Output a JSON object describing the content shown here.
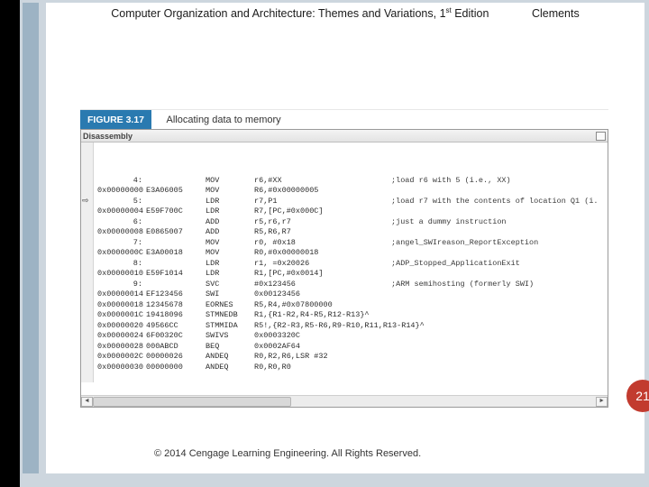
{
  "header": {
    "title_prefix": "Computer Organization and Architecture: Themes and Variations, 1",
    "title_super": "st",
    "title_suffix": " Edition",
    "author": "Clements"
  },
  "figure": {
    "badge": "FIGURE 3.17",
    "caption": "Allocating data to memory",
    "panel_title": "Disassembly",
    "rows": [
      {
        "label": "4:",
        "hex": "",
        "mnem": "MOV",
        "ops": "r6,#XX",
        "cmt": ";load r6 with 5 (i.e., XX)"
      },
      {
        "label": "0x00000000",
        "hex": "E3A06005",
        "mnem": "MOV",
        "ops": "R6,#0x00000005",
        "cmt": ""
      },
      {
        "label": "5:",
        "hex": "",
        "mnem": "LDR",
        "ops": "r7,P1",
        "cmt": ";load r7 with the contents of location Q1 (i."
      },
      {
        "label": "0x00000004",
        "hex": "E59F700C",
        "mnem": "LDR",
        "ops": "R7,[PC,#0x000C]",
        "cmt": ""
      },
      {
        "label": "6:",
        "hex": "",
        "mnem": "ADD",
        "ops": "r5,r6,r7",
        "cmt": ";just a dummy instruction"
      },
      {
        "label": "0x00000008",
        "hex": "E0865007",
        "mnem": "ADD",
        "ops": "R5,R6,R7",
        "cmt": ""
      },
      {
        "label": "7:",
        "hex": "",
        "mnem": "MOV",
        "ops": "r0, #0x18",
        "cmt": ";angel_SWIreason_ReportException"
      },
      {
        "label": "0x0000000C",
        "hex": "E3A00018",
        "mnem": "MOV",
        "ops": "R0,#0x00000018",
        "cmt": ""
      },
      {
        "label": "8:",
        "hex": "",
        "mnem": "LDR",
        "ops": "r1, =0x20026",
        "cmt": ";ADP_Stopped_ApplicationExit"
      },
      {
        "label": "0x00000010",
        "hex": "E59F1014",
        "mnem": "LDR",
        "ops": "R1,[PC,#0x0014]",
        "cmt": ""
      },
      {
        "label": "9:",
        "hex": "",
        "mnem": "SVC",
        "ops": "#0x123456",
        "cmt": ";ARM semihosting (formerly SWI)"
      },
      {
        "label": "0x00000014",
        "hex": "EF123456",
        "mnem": "SWI",
        "ops": "0x00123456",
        "cmt": ""
      },
      {
        "label": "0x00000018",
        "hex": "12345678",
        "mnem": "EORNES",
        "ops": "R5,R4,#0x07800000",
        "cmt": ""
      },
      {
        "label": "0x0000001C",
        "hex": "19418096",
        "mnem": "STMNEDB",
        "ops": "R1,{R1-R2,R4-R5,R12-R13}^",
        "cmt": ""
      },
      {
        "label": "0x00000020",
        "hex": "49566CC",
        "mnem": "STMMIDA",
        "ops": "R5!,{R2-R3,R5-R6,R9-R10,R11,R13-R14}^",
        "cmt": ""
      },
      {
        "label": "0x00000024",
        "hex": "6F00320C",
        "mnem": "SWIVS",
        "ops": "0x0003320C",
        "cmt": ""
      },
      {
        "label": "0x00000028",
        "hex": "000ABCD",
        "mnem": "BEQ",
        "ops": "0x0002AF64",
        "cmt": ""
      },
      {
        "label": "0x0000002C",
        "hex": "00000026",
        "mnem": "ANDEQ",
        "ops": "R0,R2,R6,LSR #32",
        "cmt": ""
      },
      {
        "label": "0x00000030",
        "hex": "00000000",
        "mnem": "ANDEQ",
        "ops": "R0,R0,R0",
        "cmt": ""
      }
    ],
    "arrow_row_index": 5
  },
  "page_number": "21",
  "copyright": "© 2014 Cengage Learning Engineering. All Rights Reserved."
}
